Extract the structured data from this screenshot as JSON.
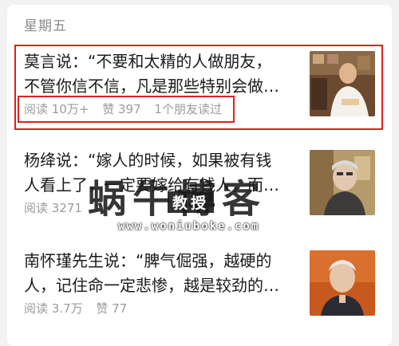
{
  "feed": {
    "day_label": "星期五",
    "articles": [
      {
        "title": "莫言说：“不要和太精的人做朋友，\n不管你信不信，凡是那些特别会做…",
        "reads": "阅读 10万+",
        "likes": "赞 397",
        "friends": "1个朋友读过"
      },
      {
        "title": "杨绛说：“嫁人的时候，如果被有钱\n人看上了，一定要嫁给有钱人，而…",
        "reads": "阅读 3271",
        "likes": "",
        "friends": ""
      },
      {
        "title": "南怀瑾先生说：“脾气倔强，越硬的\n人，记住命一定悲惨，越是较劲的…",
        "reads": "阅读 3.7万",
        "likes": "赞 77",
        "friends": ""
      }
    ]
  },
  "watermark": {
    "main": "蜗牛博客",
    "sub": "教授",
    "url": "www.woniuboke.com"
  }
}
